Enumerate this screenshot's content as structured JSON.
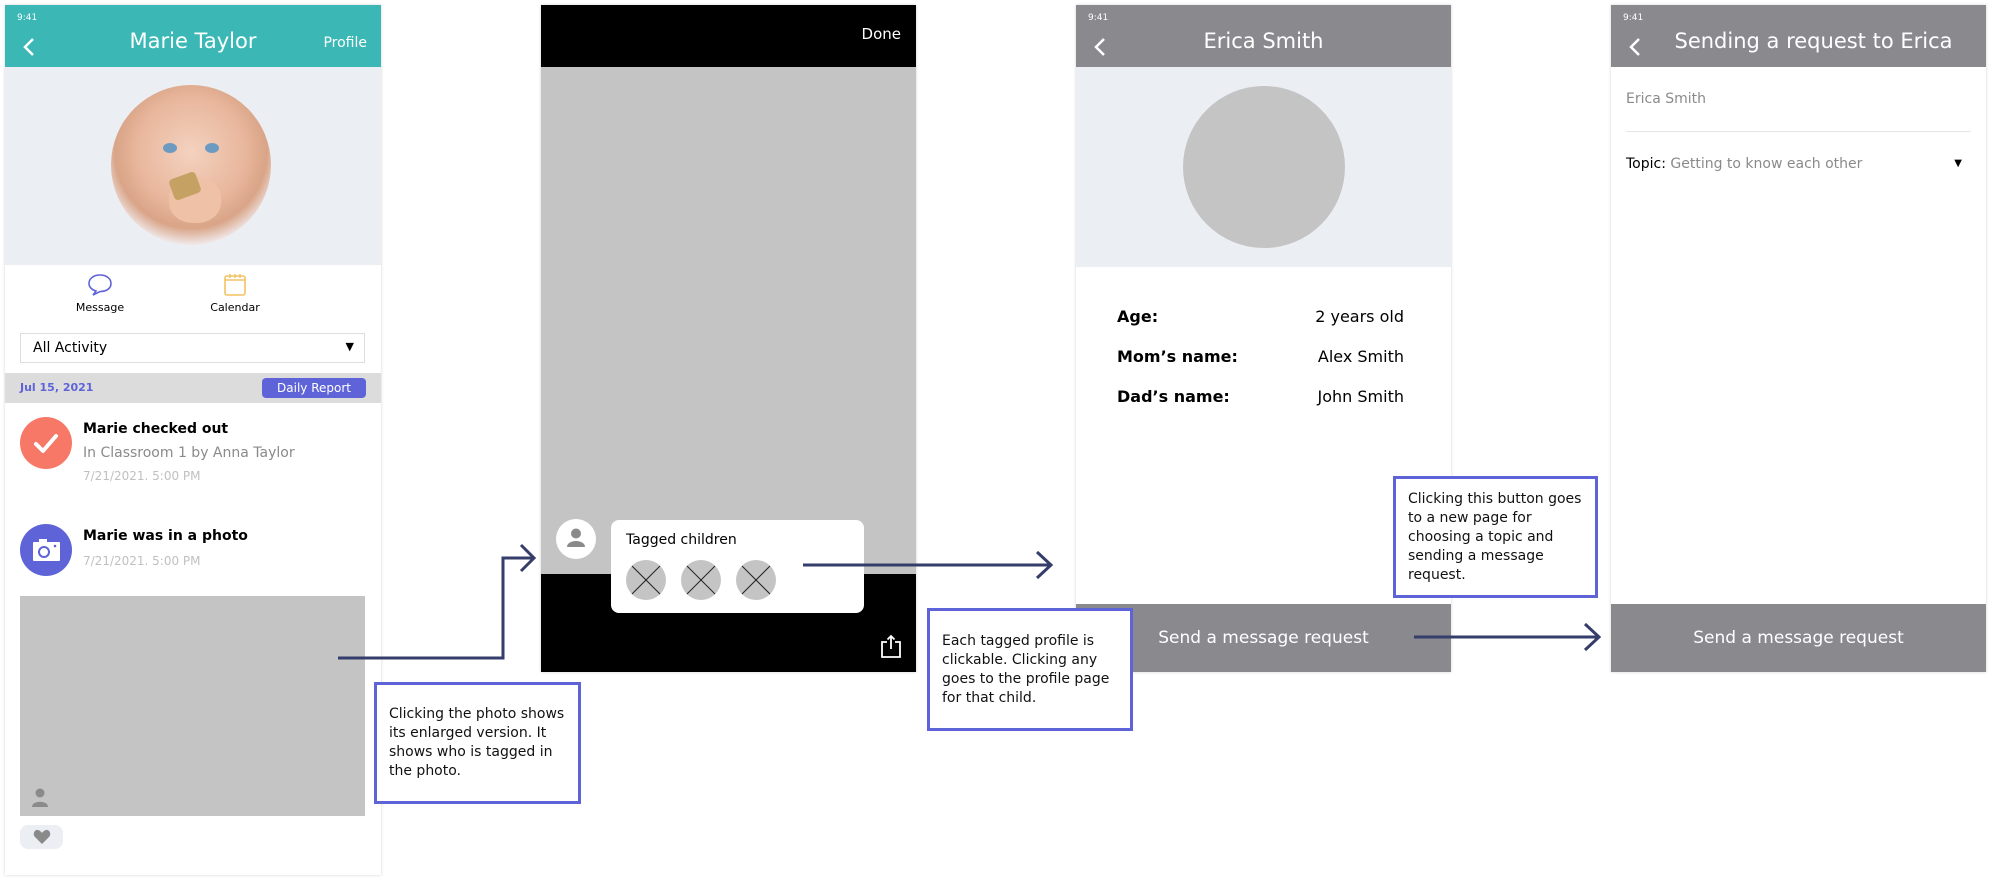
{
  "screen1": {
    "status_time": "9:41",
    "title": "Marie Taylor",
    "nav_right": "Profile",
    "actions": [
      {
        "label": "Message",
        "icon": "speech-bubble-icon"
      },
      {
        "label": "Calendar",
        "icon": "calendar-icon"
      }
    ],
    "filter": {
      "value": "All Activity"
    },
    "date": "Jul 15, 2021",
    "daily_report_label": "Daily Report",
    "feed": [
      {
        "title": "Marie checked out",
        "subtitle": "In Classroom 1 by Anna Taylor",
        "time": "7/21/2021. 5:00 PM",
        "icon": "checkmark-icon"
      },
      {
        "title": "Marie was in a photo",
        "time": "7/21/2021. 5:00 PM",
        "icon": "camera-icon"
      }
    ]
  },
  "screen2": {
    "done_label": "Done",
    "tagged_title": "Tagged children",
    "tagged_count": 3
  },
  "screen3": {
    "status_time": "9:41",
    "title": "Erica Smith",
    "info": [
      {
        "label": "Age:",
        "value": "2 years old"
      },
      {
        "label": "Mom’s name:",
        "value": "Alex Smith"
      },
      {
        "label": "Dad’s name:",
        "value": "John Smith"
      }
    ],
    "button_label": "Send a message request"
  },
  "screen4": {
    "status_time": "9:41",
    "title": "Sending a request to Erica",
    "recipient": "Erica Smith",
    "topic_label": "Topic:",
    "topic_value": "Getting to know each other",
    "button_label": "Send a message request"
  },
  "annotations": [
    "Clicking the photo shows its enlarged version. It shows who is tagged in the photo.",
    "Each tagged profile is clickable. Clicking any goes to the profile page for that child.",
    "Clicking this button goes to a new page for choosing a topic and sending a message request."
  ],
  "colors": {
    "teal": "#3bb8b6",
    "accent": "#5e64d8",
    "checkout": "#f87868",
    "gray_nav": "#8a898e",
    "arrow": "#353d6b"
  }
}
